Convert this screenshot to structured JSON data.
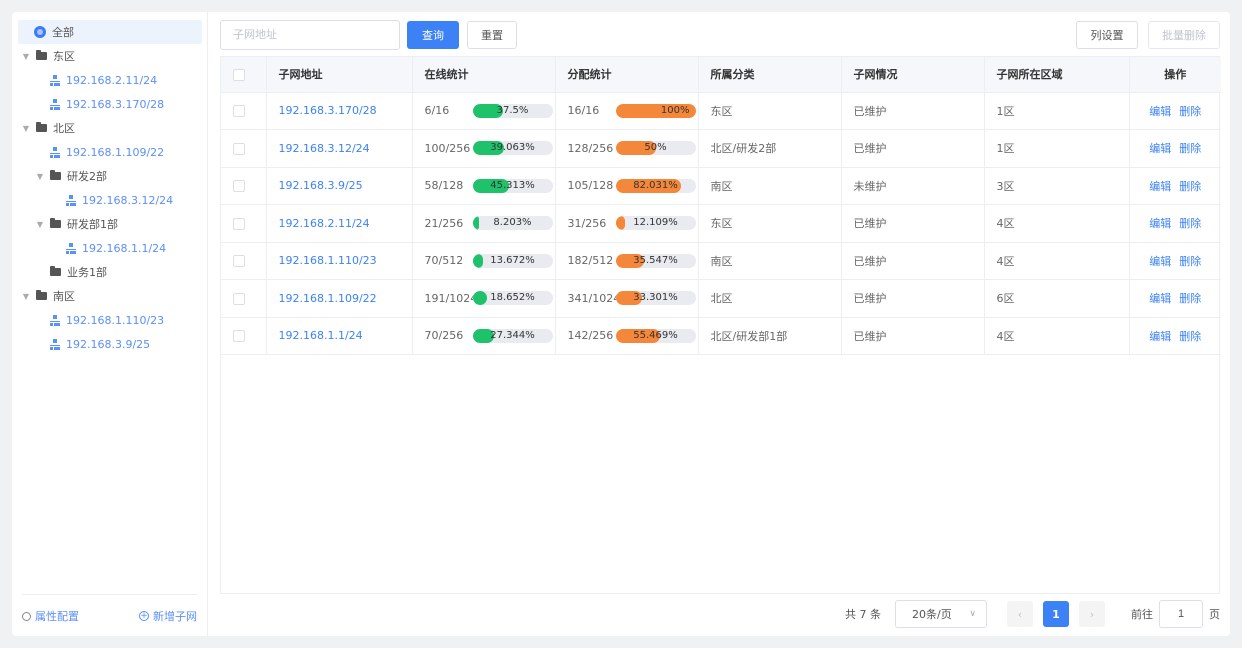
{
  "tree": {
    "root": "全部",
    "groups": [
      {
        "name": "东区",
        "subnets": [
          "192.168.2.11/24",
          "192.168.3.170/28"
        ]
      },
      {
        "name": "北区",
        "subnets": [
          "192.168.1.109/22"
        ]
      },
      {
        "name": "研发2部",
        "subnets": [
          "192.168.3.12/24"
        ]
      },
      {
        "name": "研发部1部",
        "subnets": [
          "192.168.1.1/24"
        ]
      },
      {
        "name": "业务1部",
        "subnets": []
      },
      {
        "name": "南区",
        "subnets": [
          "192.168.1.110/23",
          "192.168.3.9/25"
        ]
      }
    ],
    "footer": {
      "config": "属性配置",
      "add": "新增子网"
    }
  },
  "toolbar": {
    "search_placeholder": "子网地址",
    "query": "查询",
    "reset": "重置",
    "columns": "列设置",
    "batch_delete": "批量删除"
  },
  "table": {
    "headers": [
      "子网地址",
      "在线统计",
      "分配统计",
      "所属分类",
      "子网情况",
      "子网所在区域",
      "操作"
    ],
    "rows": [
      {
        "ip": "192.168.3.170/28",
        "online": "6/16",
        "online_pct": "37.5%",
        "online_frac": 0.375,
        "alloc": "16/16",
        "alloc_pct": "100%",
        "alloc_frac": 1.0,
        "category": "东区",
        "status": "已维护",
        "area": "1区"
      },
      {
        "ip": "192.168.3.12/24",
        "online": "100/256",
        "online_pct": "39.063%",
        "online_frac": 0.391,
        "alloc": "128/256",
        "alloc_pct": "50%",
        "alloc_frac": 0.5,
        "category": "北区/研发2部",
        "status": "已维护",
        "area": "1区"
      },
      {
        "ip": "192.168.3.9/25",
        "online": "58/128",
        "online_pct": "45.313%",
        "online_frac": 0.453,
        "alloc": "105/128",
        "alloc_pct": "82.031%",
        "alloc_frac": 0.82,
        "category": "南区",
        "status": "未维护",
        "area": "3区"
      },
      {
        "ip": "192.168.2.11/24",
        "online": "21/256",
        "online_pct": "8.203%",
        "online_frac": 0.082,
        "alloc": "31/256",
        "alloc_pct": "12.109%",
        "alloc_frac": 0.121,
        "category": "东区",
        "status": "已维护",
        "area": "4区"
      },
      {
        "ip": "192.168.1.110/23",
        "online": "70/512",
        "online_pct": "13.672%",
        "online_frac": 0.137,
        "alloc": "182/512",
        "alloc_pct": "35.547%",
        "alloc_frac": 0.355,
        "category": "南区",
        "status": "已维护",
        "area": "4区"
      },
      {
        "ip": "192.168.1.109/22",
        "online": "191/1024",
        "online_pct": "18.652%",
        "online_frac": 0.187,
        "alloc": "341/1024",
        "alloc_pct": "33.301%",
        "alloc_frac": 0.333,
        "category": "北区",
        "status": "已维护",
        "area": "6区"
      },
      {
        "ip": "192.168.1.1/24",
        "online": "70/256",
        "online_pct": "27.344%",
        "online_frac": 0.273,
        "alloc": "142/256",
        "alloc_pct": "55.469%",
        "alloc_frac": 0.555,
        "category": "北区/研发部1部",
        "status": "已维护",
        "area": "4区"
      }
    ],
    "actions": {
      "edit": "编辑",
      "delete": "删除"
    }
  },
  "pagination": {
    "total": "共 7 条",
    "page_size": "20条/页",
    "prev": "‹",
    "current": "1",
    "next": "›",
    "goto_label": "前往",
    "goto_value": "1",
    "page_unit": "页"
  },
  "colors": {
    "primary": "#3c82f6",
    "online_bar": "#1ec26b",
    "alloc_bar": "#f4873a"
  }
}
